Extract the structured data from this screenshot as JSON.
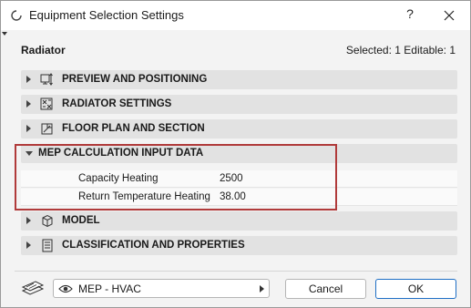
{
  "window": {
    "title": "Equipment Selection Settings",
    "help_label": "?",
    "close_label": "✕"
  },
  "header": {
    "element_name": "Radiator",
    "selection_info": "Selected: 1 Editable: 1"
  },
  "panels": [
    {
      "label": "PREVIEW AND POSITIONING",
      "icon": "preview-positioning-icon",
      "expanded": false
    },
    {
      "label": "RADIATOR SETTINGS",
      "icon": "radiator-settings-icon",
      "expanded": false
    },
    {
      "label": "FLOOR PLAN AND SECTION",
      "icon": "floor-plan-section-icon",
      "expanded": false
    },
    {
      "label": "MEP CALCULATION INPUT DATA",
      "icon": "",
      "expanded": true
    },
    {
      "label": "MODEL",
      "icon": "model-cube-icon",
      "expanded": false
    },
    {
      "label": "CLASSIFICATION AND PROPERTIES",
      "icon": "classification-icon",
      "expanded": false
    }
  ],
  "mep_rows": [
    {
      "name": "Capacity Heating",
      "value": "2500"
    },
    {
      "name": "Return Temperature Heating",
      "value": "38.00"
    }
  ],
  "footer": {
    "layer_value": "MEP - HVAC",
    "cancel_label": "Cancel",
    "ok_label": "OK"
  },
  "colors": {
    "highlight_border": "#b03a3a",
    "ok_border": "#1f6fc5"
  }
}
